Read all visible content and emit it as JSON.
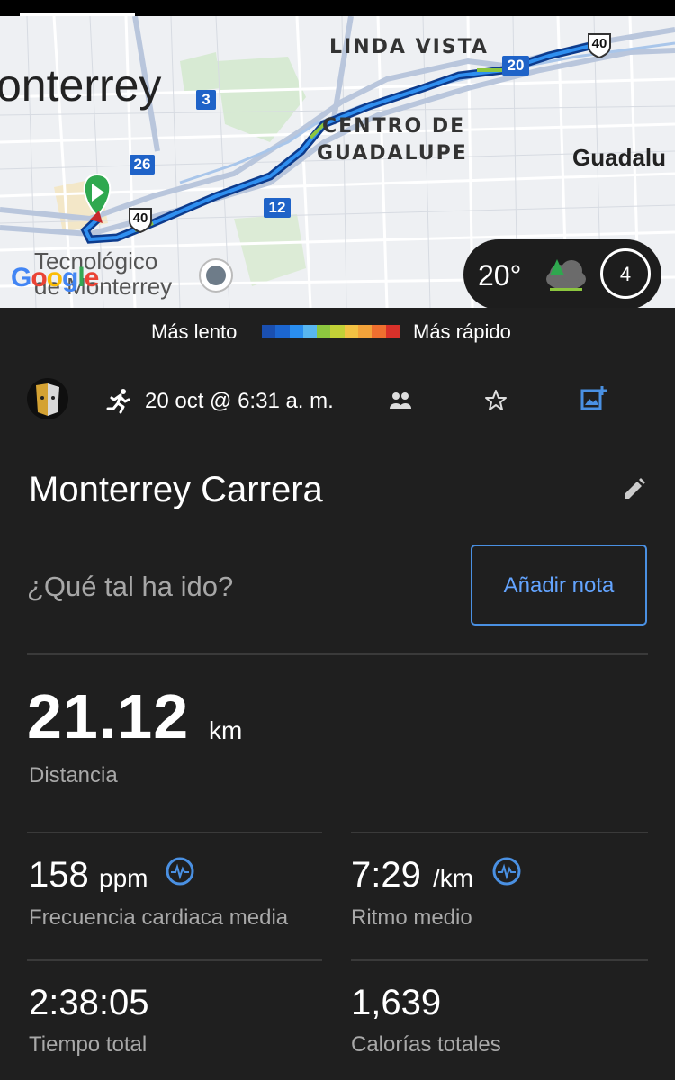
{
  "map": {
    "labels": {
      "linda_vista": "LINDA VISTA",
      "centro_1": "CENTRO DE",
      "centro_2": "GUADALUPE",
      "city": "onterrey",
      "guadalupe": "Guadalu",
      "tec_1": "Tecnológico",
      "tec_2": "de Monterrey",
      "google": "Google"
    },
    "highways": {
      "h3": "3",
      "h26": "26",
      "h12": "12",
      "h20": "20",
      "h40a": "40",
      "h40b": "40"
    },
    "weather": {
      "temp": "20°",
      "wind": "4"
    }
  },
  "legend": {
    "slow": "Más lento",
    "fast": "Más rápido",
    "colors": [
      "#1a4fb0",
      "#1c66d0",
      "#2a8ef0",
      "#58b6f0",
      "#8cc63f",
      "#c2d137",
      "#f3c243",
      "#f3a33a",
      "#ef6f2f",
      "#d9312a"
    ]
  },
  "activity": {
    "date": "20 oct @ 6:31 a. m.",
    "title": "Monterrey Carrera",
    "prompt": "¿Qué tal ha ido?",
    "add_note": "Añadir nota"
  },
  "stats": {
    "distance": {
      "value": "21.12",
      "unit": "km",
      "label": "Distancia"
    },
    "hr": {
      "value": "158",
      "unit": "ppm",
      "label": "Frecuencia cardiaca media"
    },
    "pace": {
      "value": "7:29",
      "unit": "/km",
      "label": "Ritmo medio"
    },
    "time": {
      "value": "2:38:05",
      "label": "Tiempo total"
    },
    "calories": {
      "value": "1,639",
      "label": "Calorías totales"
    }
  },
  "colors": {
    "accent": "#4a90e2",
    "background": "#1f1f1f"
  }
}
